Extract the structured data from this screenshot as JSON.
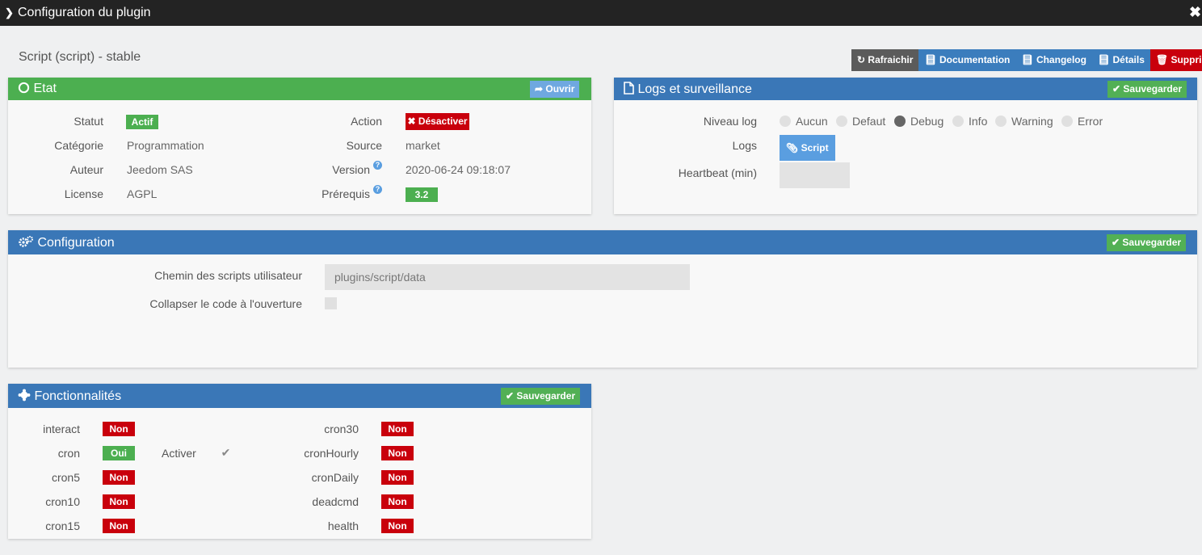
{
  "modal": {
    "title": "Configuration du plugin"
  },
  "plugin": {
    "name": "Script (script) - stable"
  },
  "toolbar": {
    "refresh": "Rafraichir",
    "documentation": "Documentation",
    "changelog": "Changelog",
    "details": "Détails",
    "delete": "Supprimer"
  },
  "state": {
    "title": "Etat",
    "open_label": "Ouvrir",
    "status_label": "Statut",
    "status_value": "Actif",
    "category_label": "Catégorie",
    "category_value": "Programmation",
    "author_label": "Auteur",
    "author_value": "Jeedom SAS",
    "license_label": "License",
    "license_value": "AGPL",
    "action_label": "Action",
    "action_value": "Désactiver",
    "source_label": "Source",
    "source_value": "market",
    "version_label": "Version",
    "version_value": "2020-06-24 09:18:07",
    "prereq_label": "Prérequis",
    "prereq_value": "3.2"
  },
  "logs": {
    "title": "Logs et surveillance",
    "save_label": "Sauvegarder",
    "level_label": "Niveau log",
    "levels": [
      {
        "label": "Aucun",
        "selected": false
      },
      {
        "label": "Defaut",
        "selected": false
      },
      {
        "label": "Debug",
        "selected": true
      },
      {
        "label": "Info",
        "selected": false
      },
      {
        "label": "Warning",
        "selected": false
      },
      {
        "label": "Error",
        "selected": false
      }
    ],
    "logs_label": "Logs",
    "script_button": "Script",
    "heartbeat_label": "Heartbeat (min)",
    "heartbeat_value": ""
  },
  "configuration": {
    "title": "Configuration",
    "save_label": "Sauvegarder",
    "path_label": "Chemin des scripts utilisateur",
    "path_value": "plugins/script/data",
    "collapse_label": "Collapser le code à l'ouverture",
    "collapse_checked": false
  },
  "features": {
    "title": "Fonctionnalités",
    "save_label": "Sauvegarder",
    "activate_label": "Activer",
    "activate_checked": true,
    "left": [
      {
        "name": "interact",
        "value": "Non"
      },
      {
        "name": "cron",
        "value": "Oui"
      },
      {
        "name": "cron5",
        "value": "Non"
      },
      {
        "name": "cron10",
        "value": "Non"
      },
      {
        "name": "cron15",
        "value": "Non"
      }
    ],
    "right": [
      {
        "name": "cron30",
        "value": "Non"
      },
      {
        "name": "cronHourly",
        "value": "Non"
      },
      {
        "name": "cronDaily",
        "value": "Non"
      },
      {
        "name": "deadcmd",
        "value": "Non"
      },
      {
        "name": "health",
        "value": "Non"
      }
    ]
  },
  "colors": {
    "green": "#4caf50",
    "blue": "#3a77b7",
    "red": "#c9000c",
    "dark": "#232323"
  }
}
